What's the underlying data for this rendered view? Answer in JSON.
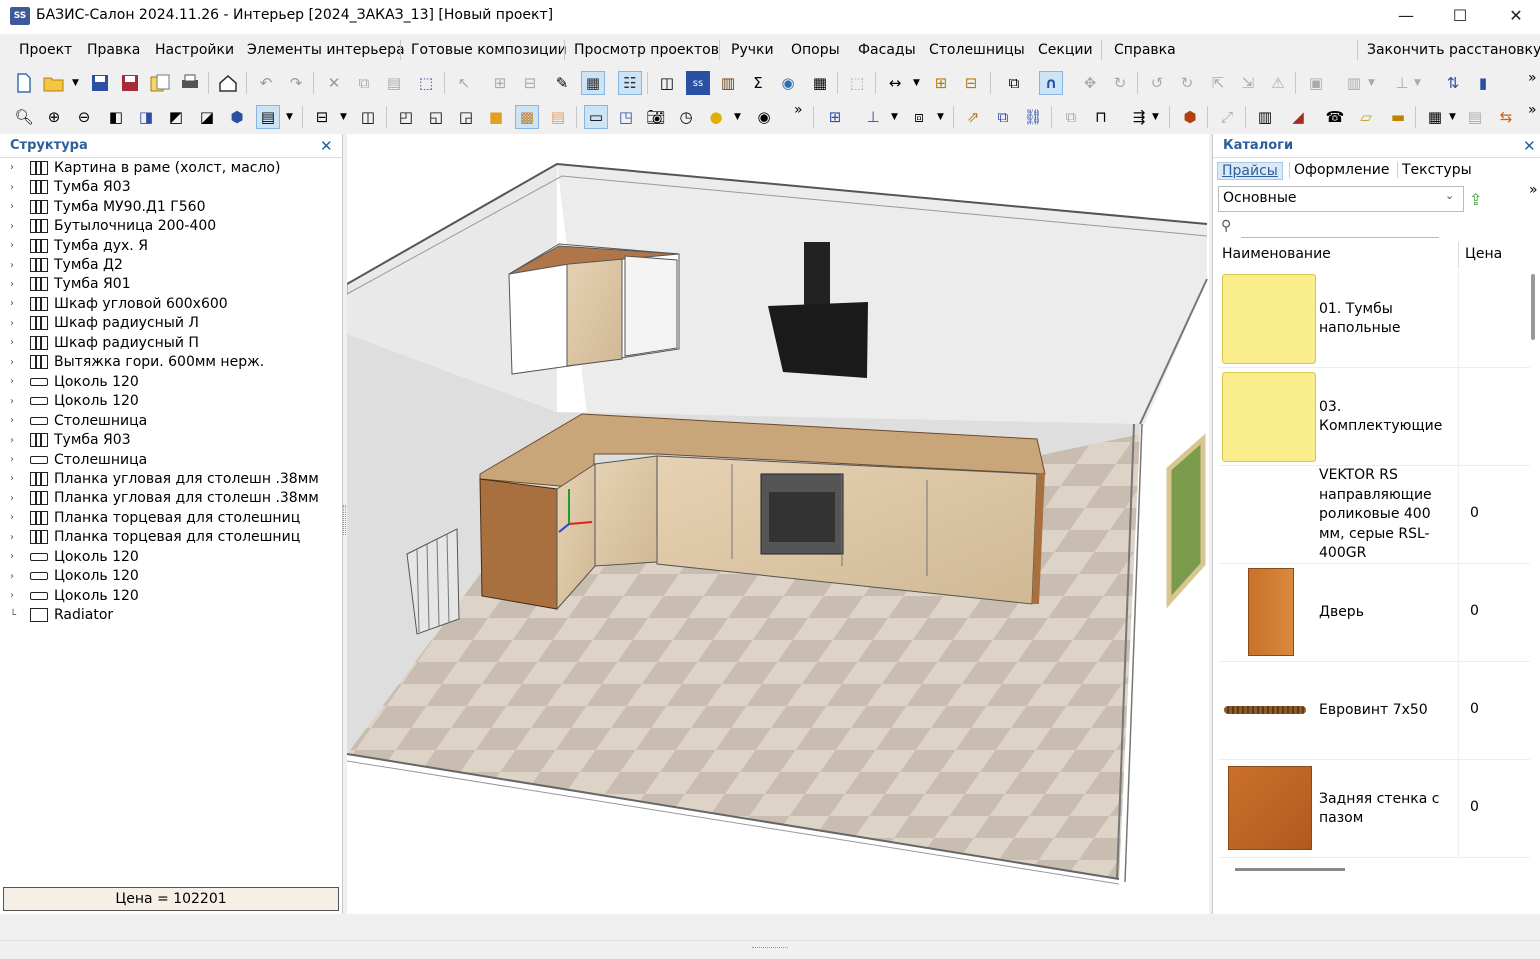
{
  "window": {
    "title": "БАЗИС-Салон 2024.11.26 - Интерьер [2024_ЗАКАЗ_13] [Новый проект]",
    "app_icon_text": "SS",
    "minimize": "—",
    "maximize": "☐",
    "close": "✕"
  },
  "menu": {
    "items": [
      "Проект",
      "Правка",
      "Настройки",
      "Элементы интерьера",
      "Готовые композиции",
      "Просмотр проектов",
      "Ручки",
      "Опоры",
      "Фасады",
      "Столешницы",
      "Секции",
      "Справка"
    ],
    "finish": "Закончить расстановку"
  },
  "toolbar1": {
    "icons": [
      "new-file-icon",
      "open-folder-icon",
      "save-icon",
      "save-as-icon",
      "copy-project-icon",
      "print-icon",
      "home-icon",
      "undo-icon",
      "redo-icon",
      "delete-icon",
      "copy-icon",
      "paste-icon",
      "select-icon",
      "pointer-icon",
      "group-icon",
      "ungroup-icon",
      "edit-icon",
      "catalog-icon",
      "tree-icon",
      "cabinet-icon",
      "basis-icon",
      "panel-icon",
      "sum-icon",
      "view-icon",
      "calculator-icon",
      "box-icon",
      "dimension-icon",
      "section-icon",
      "columns-icon",
      "rotate-icon",
      "magnet-icon",
      "move-icon",
      "refresh-icon",
      "rotate-left-icon",
      "rotate-right-icon",
      "align-icon",
      "mirror-icon",
      "bars-icon",
      "distribute-icon",
      "stack-icon",
      "export-icon",
      "chart-icon"
    ],
    "overflow": "»"
  },
  "toolbar2": {
    "icons": [
      "zoom-fit-icon",
      "zoom-in-icon",
      "zoom-out-icon",
      "view-front-icon",
      "view-back-icon",
      "view-left-icon",
      "view-right-icon",
      "view-top-icon",
      "view-iso-icon",
      "render-wire-icon",
      "render-mode-icon",
      "box-wire-icon",
      "box-hidden-icon",
      "box-shaded-icon",
      "box-solid-icon",
      "box-textured-icon",
      "box-outline-icon",
      "frame-icon",
      "frame2-icon",
      "camera-icon",
      "clock-icon",
      "light-icon",
      "eye-icon",
      "add-panel-icon",
      "place-icon",
      "layers-icon",
      "move-arrow-icon",
      "resize-icon",
      "link-icon",
      "duplicate-icon",
      "measure-icon",
      "tape-icon",
      "ruler-icon",
      "sphere-icon",
      "grid-icon",
      "shelf-icon",
      "handle-icon",
      "pipe-icon",
      "plank-icon",
      "edge-icon",
      "table-icon",
      "doc-icon",
      "warning-icon"
    ],
    "overflow": "»"
  },
  "structure": {
    "title": "Структура",
    "close": "✕",
    "items": [
      {
        "label": "Картина в раме (холст, масло)",
        "icon": "cabinet"
      },
      {
        "label": "Тумба Я03",
        "icon": "cabinet"
      },
      {
        "label": "Тумба МУ90.Д1 Г560",
        "icon": "cabinet"
      },
      {
        "label": "Бутылочница 200-400",
        "icon": "cabinet"
      },
      {
        "label": "Тумба дух. Я",
        "icon": "cabinet"
      },
      {
        "label": "Тумба Д2",
        "icon": "cabinet"
      },
      {
        "label": "Тумба Я01",
        "icon": "cabinet"
      },
      {
        "label": "Шкаф угловой 600х600",
        "icon": "cabinet"
      },
      {
        "label": "Шкаф радиусный Л",
        "icon": "cabinet"
      },
      {
        "label": "Шкаф радиусный П",
        "icon": "cabinet"
      },
      {
        "label": "Вытяжка гори. 600мм нерж.",
        "icon": "cabinet"
      },
      {
        "label": "Цоколь 120",
        "icon": "plinth"
      },
      {
        "label": "Цоколь 120",
        "icon": "plinth"
      },
      {
        "label": "Столешница",
        "icon": "plinth"
      },
      {
        "label": "Тумба Я03",
        "icon": "cabinet"
      },
      {
        "label": "Столешница",
        "icon": "plinth"
      },
      {
        "label": "Планка угловая для столешн .38мм",
        "icon": "cabinet"
      },
      {
        "label": "Планка угловая для столешн .38мм",
        "icon": "cabinet"
      },
      {
        "label": "Планка торцевая  для столешниц",
        "icon": "cabinet"
      },
      {
        "label": "Планка торцевая  для столешниц",
        "icon": "cabinet"
      },
      {
        "label": "Цоколь 120",
        "icon": "plinth"
      },
      {
        "label": "Цоколь 120",
        "icon": "plinth"
      },
      {
        "label": "Цоколь 120",
        "icon": "plinth"
      },
      {
        "label": "Radiator",
        "icon": "empty"
      }
    ],
    "price": "Цена = 102201"
  },
  "catalogs": {
    "title": "Каталоги",
    "close": "✕",
    "tabs": [
      "Прайсы",
      "Оформление",
      "Текстуры"
    ],
    "selected": "Основные",
    "overflow": "»",
    "columns": {
      "name": "Наименование",
      "price": "Цена"
    },
    "rows": [
      {
        "name": "01. Тумбы напольные",
        "price": "",
        "thumb": "folder"
      },
      {
        "name": "03. Комплектующие",
        "price": "",
        "thumb": "folder"
      },
      {
        "name": "VEKTOR RS направляющие роликовые 400 мм, серые RSL-400GR",
        "price": "0",
        "thumb": "none"
      },
      {
        "name": "Дверь",
        "price": "0",
        "thumb": "door"
      },
      {
        "name": "Евровинт 7х50",
        "price": "0",
        "thumb": "screw"
      },
      {
        "name": "Задняя стенка с пазом",
        "price": "0",
        "thumb": "panel"
      }
    ]
  }
}
